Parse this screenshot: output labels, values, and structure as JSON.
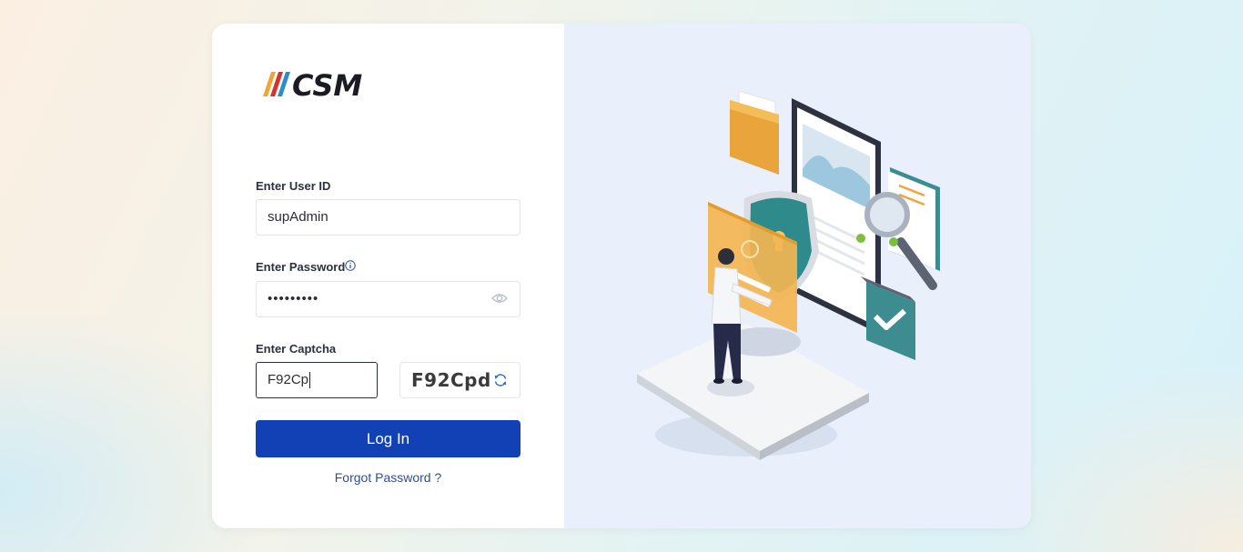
{
  "brand": {
    "logo_text": "CSM",
    "stripe_colors": [
      "#f0a537",
      "#d8322b",
      "#2b8ec8"
    ],
    "text_color": "#1b1b24"
  },
  "form": {
    "user_id": {
      "label": "Enter User ID",
      "value": "supAdmin"
    },
    "password": {
      "label": "Enter Password",
      "masked_value": "•••••••••",
      "info_icon": "info-icon",
      "toggle_icon": "eye-icon"
    },
    "captcha": {
      "label": "Enter Captcha",
      "value": "F92Cp",
      "challenge": "F92Cpd",
      "refresh_icon": "refresh-icon"
    },
    "login_label": "Log In",
    "forgot_label": "Forgot Password ?"
  },
  "colors": {
    "primary": "#1240b5",
    "link": "#2a4f9a",
    "illustration_bg": "#e9f0fb"
  }
}
